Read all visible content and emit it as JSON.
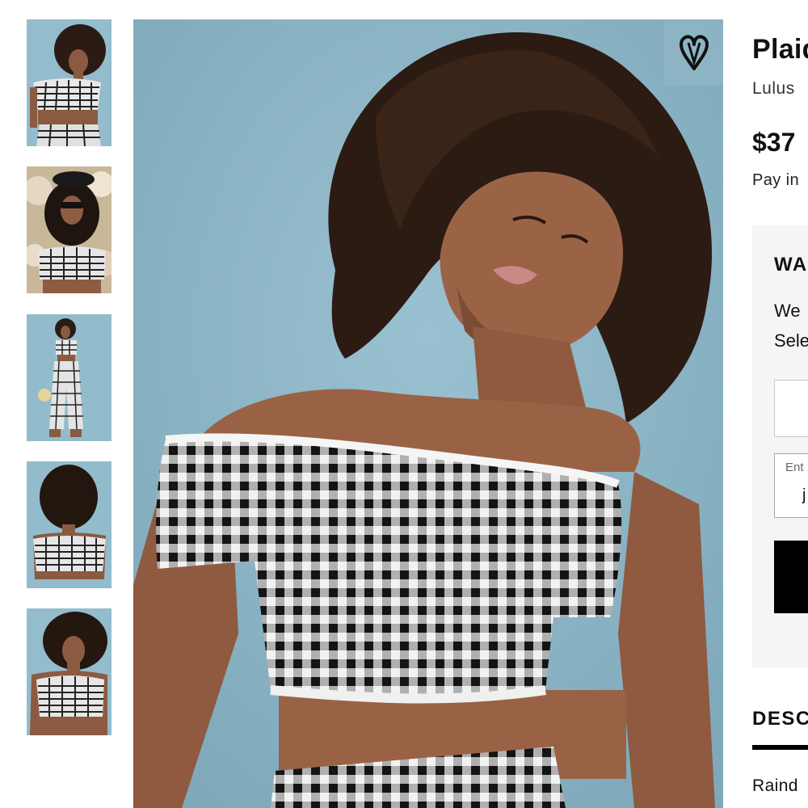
{
  "product": {
    "title": "Plaid",
    "brand": "Lulus",
    "price": "$37",
    "pay_in": "Pay in"
  },
  "waitlist": {
    "title": "WA",
    "line1": "We",
    "line2": "Sele",
    "email_label": "Ent",
    "email_value": "j"
  },
  "tabs": {
    "description": "DESC"
  },
  "description": {
    "text": "Raind"
  },
  "icons": {
    "wishlist": "heart-outline-icon",
    "size_dropdown": "chevron-down-icon"
  },
  "colors": {
    "accent": "#000000",
    "photo_background": "#8db5c6",
    "panel_background": "#f5f5f5"
  },
  "gallery": {
    "thumbnails": [
      "thumbnail-front-pose",
      "thumbnail-sunglasses-hat",
      "thumbnail-full-body",
      "thumbnail-back-view",
      "thumbnail-front-closeup"
    ],
    "selected_index": 0
  }
}
